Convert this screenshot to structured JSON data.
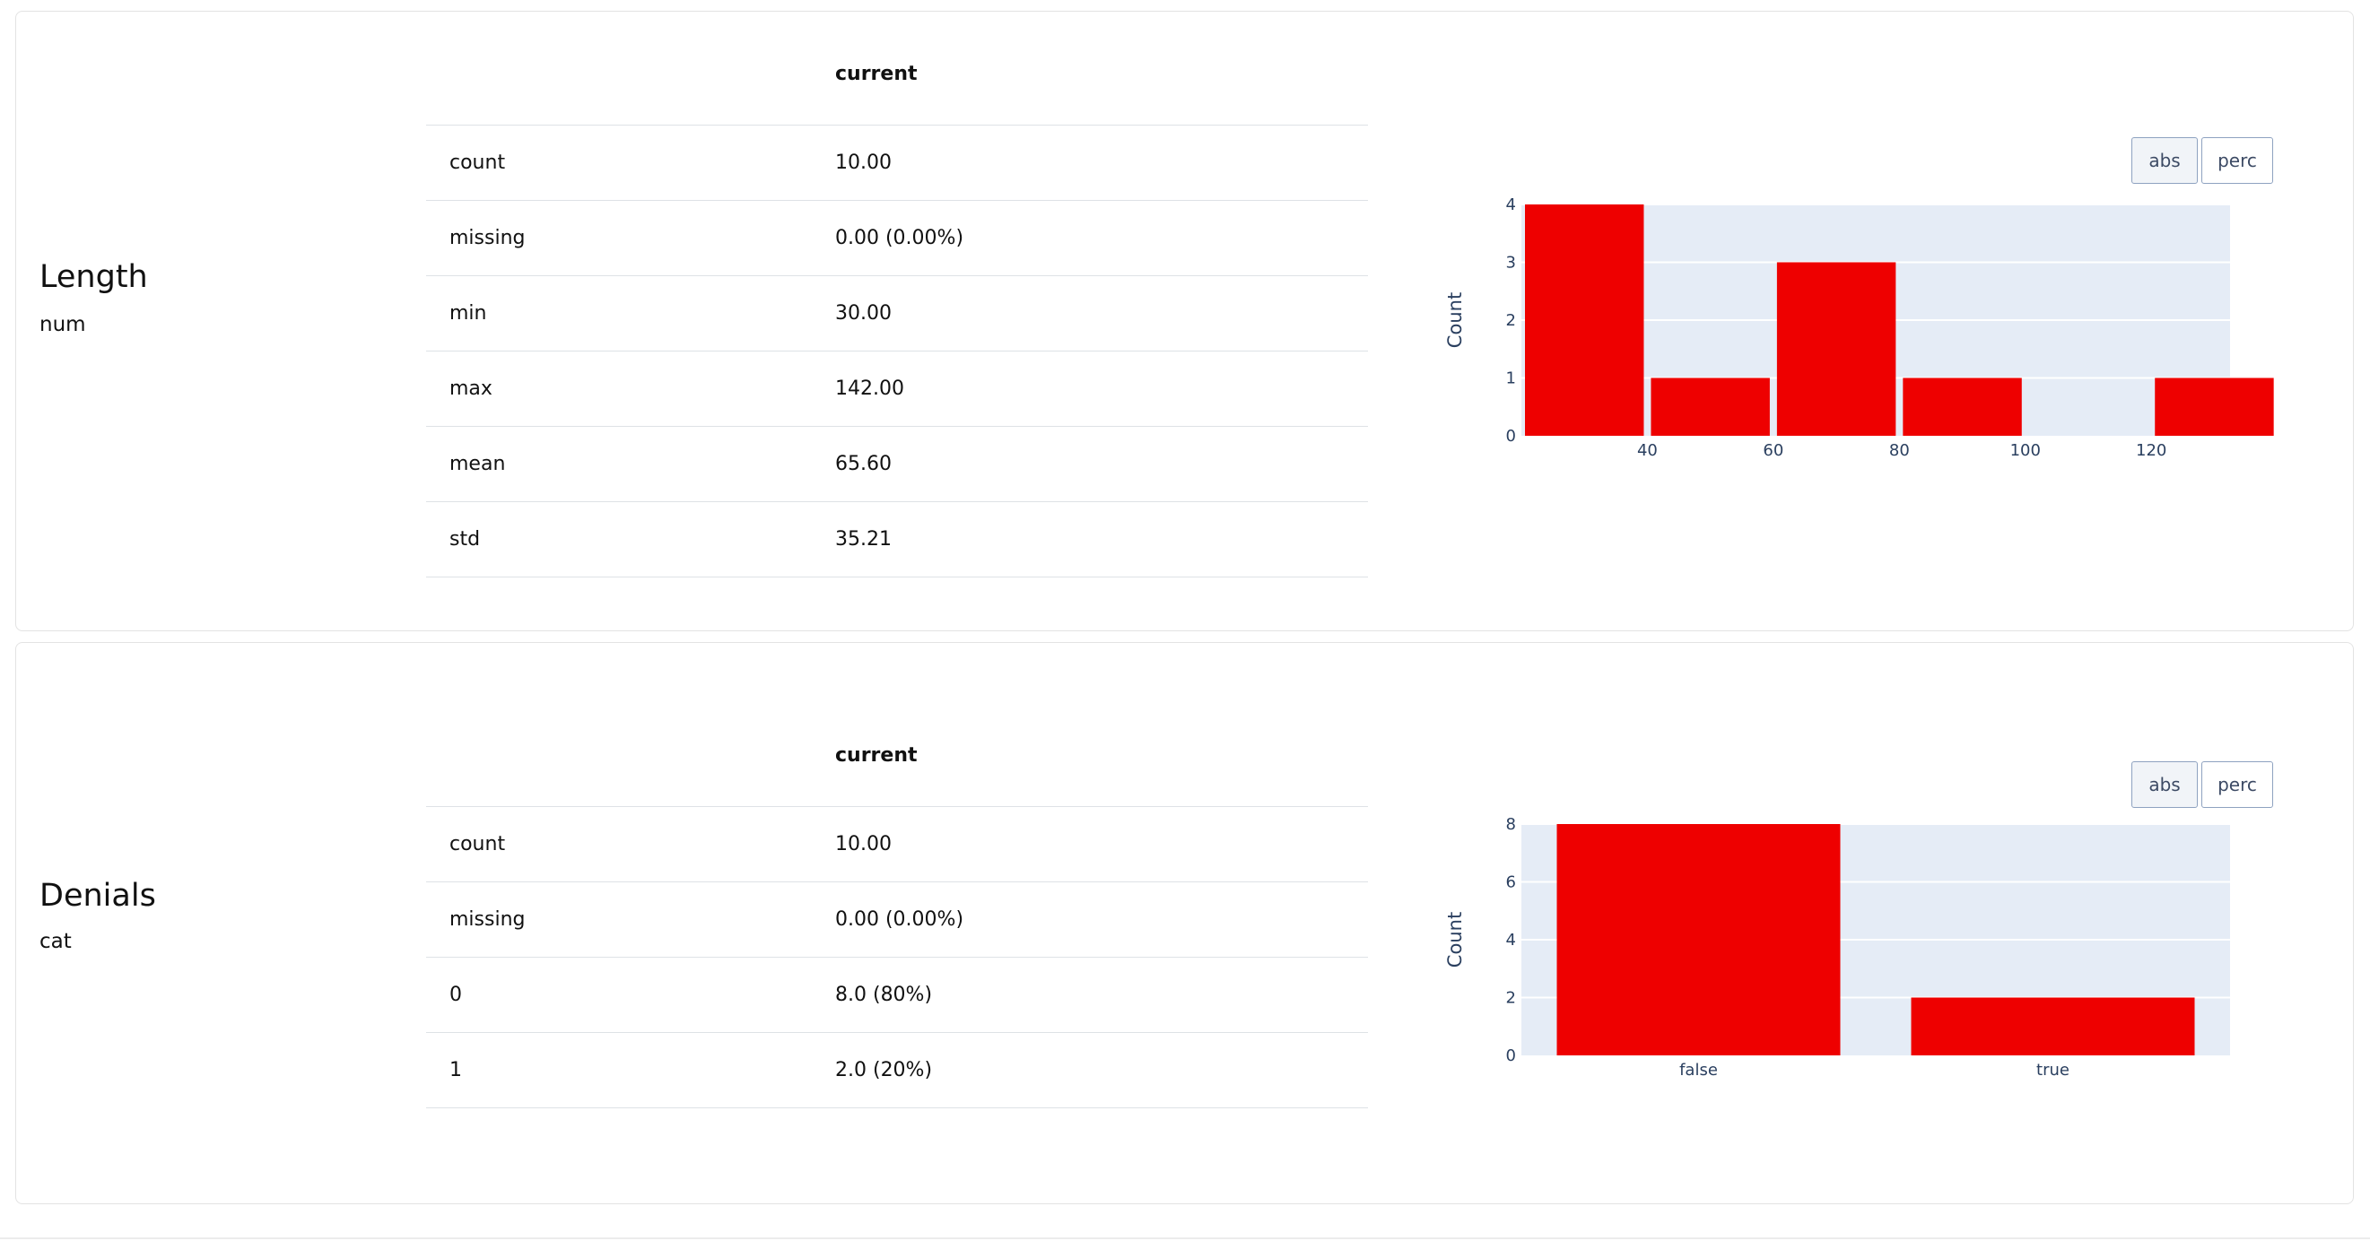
{
  "features": [
    {
      "name": "Length",
      "type": "num",
      "table": {
        "header": "current",
        "rows": [
          {
            "label": "count",
            "value": "10.00"
          },
          {
            "label": "missing",
            "value": "0.00 (0.00%)"
          },
          {
            "label": "min",
            "value": "30.00"
          },
          {
            "label": "max",
            "value": "142.00"
          },
          {
            "label": "mean",
            "value": "65.60"
          },
          {
            "label": "std",
            "value": "35.21"
          }
        ]
      },
      "buttons": {
        "abs": "abs",
        "perc": "perc"
      },
      "chart_data": {
        "type": "bar",
        "title": "",
        "xlabel": "",
        "ylabel": "Count",
        "bins": [
          {
            "x0": 20,
            "x1": 40,
            "value": 4
          },
          {
            "x0": 40,
            "x1": 60,
            "value": 1
          },
          {
            "x0": 60,
            "x1": 80,
            "value": 3
          },
          {
            "x0": 80,
            "x1": 100,
            "value": 1
          },
          {
            "x0": 100,
            "x1": 120,
            "value": 0
          },
          {
            "x0": 120,
            "x1": 140,
            "value": 1
          }
        ],
        "xticks": [
          "40",
          "60",
          "80",
          "100",
          "120"
        ],
        "yticks": [
          "0",
          "1",
          "2",
          "3",
          "4"
        ],
        "ylim": [
          0,
          4
        ],
        "bar_color": "#ee0000",
        "grid": true
      }
    },
    {
      "name": "Denials",
      "type": "cat",
      "table": {
        "header": "current",
        "rows": [
          {
            "label": "count",
            "value": "10.00"
          },
          {
            "label": "missing",
            "value": "0.00 (0.00%)"
          },
          {
            "label": "0",
            "value": "8.0 (80%)"
          },
          {
            "label": "1",
            "value": "2.0 (20%)"
          }
        ]
      },
      "buttons": {
        "abs": "abs",
        "perc": "perc"
      },
      "chart_data": {
        "type": "bar",
        "title": "",
        "xlabel": "",
        "ylabel": "Count",
        "categories": [
          "false",
          "true"
        ],
        "values": [
          8,
          2
        ],
        "yticks": [
          "0",
          "2",
          "4",
          "6",
          "8"
        ],
        "ylim": [
          0,
          8
        ],
        "bar_color": "#ee0000",
        "grid": true
      }
    }
  ]
}
